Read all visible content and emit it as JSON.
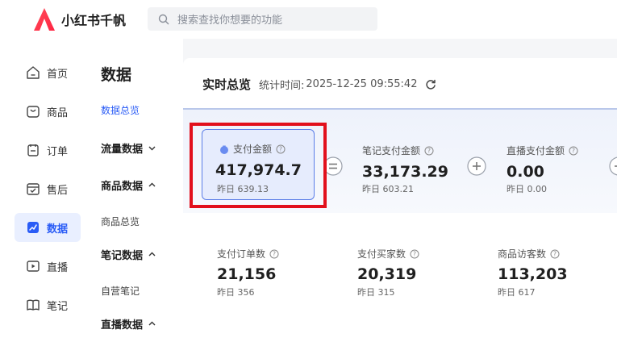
{
  "app": {
    "name": "小红书千帆"
  },
  "search": {
    "placeholder": "搜索查找你想要的功能"
  },
  "nav": [
    {
      "label": "首页",
      "icon": "home-icon"
    },
    {
      "label": "商品",
      "icon": "product-icon"
    },
    {
      "label": "订单",
      "icon": "order-icon"
    },
    {
      "label": "售后",
      "icon": "after-sales-icon"
    },
    {
      "label": "数据",
      "icon": "data-icon",
      "active": true
    },
    {
      "label": "直播",
      "icon": "live-icon"
    },
    {
      "label": "笔记",
      "icon": "notes-icon"
    }
  ],
  "subnav": {
    "title": "数据",
    "items": [
      {
        "label": "数据总览",
        "type": "link",
        "active": true
      },
      {
        "label": "流量数据",
        "type": "group",
        "expanded": false
      },
      {
        "label": "商品数据",
        "type": "group",
        "expanded": true
      },
      {
        "label": "商品总览",
        "type": "link"
      },
      {
        "label": "笔记数据",
        "type": "group",
        "expanded": true
      },
      {
        "label": "自营笔记",
        "type": "link"
      },
      {
        "label": "直播数据",
        "type": "group",
        "expanded": true
      }
    ]
  },
  "overview": {
    "title": "实时总览",
    "stat_label": "统计时间:",
    "stat_time": "2025-12-25 09:55:42"
  },
  "metrics_top": [
    {
      "label": "支付金额",
      "value": "417,974.7",
      "prev": "昨日 639.13"
    },
    {
      "label": "笔记支付金额",
      "value": "33,173.29",
      "prev": "昨日 603.21"
    },
    {
      "label": "直播支付金额",
      "value": "0.00",
      "prev": "昨日 0.00"
    }
  ],
  "metrics_bottom": [
    {
      "label": "支付订单数",
      "value": "21,156",
      "prev": "昨日 356"
    },
    {
      "label": "支付买家数",
      "value": "20,319",
      "prev": "昨日 315"
    },
    {
      "label": "商品访客数",
      "value": "113,203",
      "prev": "昨日 617"
    }
  ],
  "colors": {
    "accent": "#2a5cf6",
    "highlight": "#e2101c",
    "brand": "#ff2442"
  }
}
